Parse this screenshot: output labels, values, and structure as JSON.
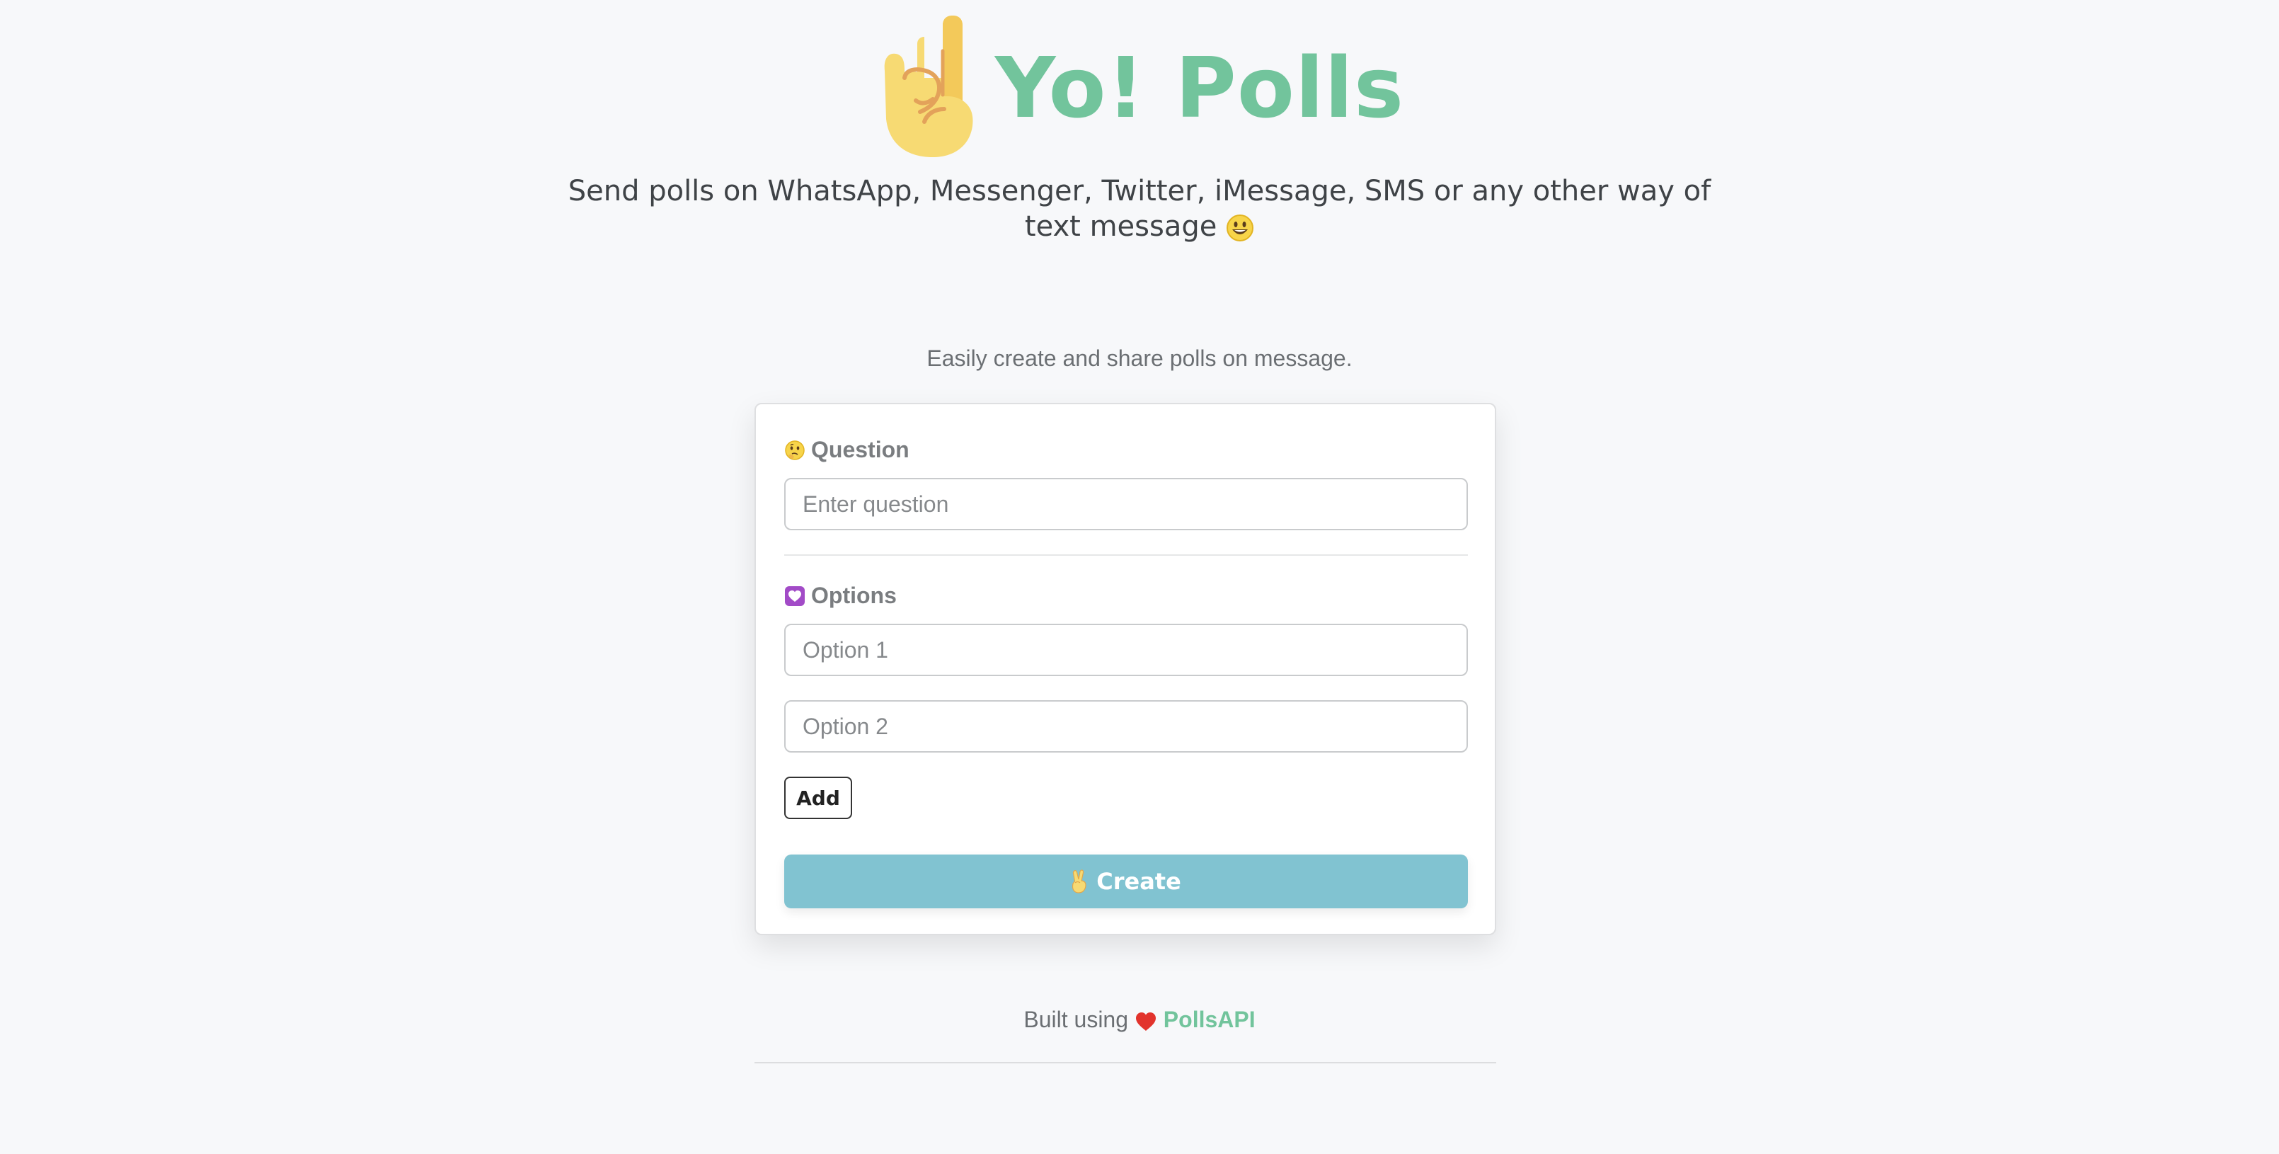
{
  "header": {
    "brand": "Yo! Polls",
    "logo_icon": "raised-hand-index-finger-icon"
  },
  "tagline": {
    "text": "Send polls on WhatsApp, Messenger, Twitter, iMessage, SMS or any other way of text message",
    "emoji_icon": "smiley-face-icon"
  },
  "subtitle": "Easily create and share polls on message.",
  "form": {
    "question": {
      "label": "Question",
      "label_icon": "thinking-face-icon",
      "placeholder": "Enter question",
      "value": ""
    },
    "options": {
      "label": "Options",
      "label_icon": "heart-box-icon",
      "items": [
        {
          "placeholder": "Option 1",
          "value": ""
        },
        {
          "placeholder": "Option 2",
          "value": ""
        }
      ]
    },
    "add_label": "Add",
    "create_label": "Create",
    "create_icon": "victory-hand-icon"
  },
  "footer": {
    "prefix": "Built using",
    "heart_icon": "red-heart-icon",
    "link_text": "PollsAPI"
  },
  "colors": {
    "brand_green": "#72c49c",
    "create_button": "#81c3d1",
    "background": "#f7f8fa"
  }
}
